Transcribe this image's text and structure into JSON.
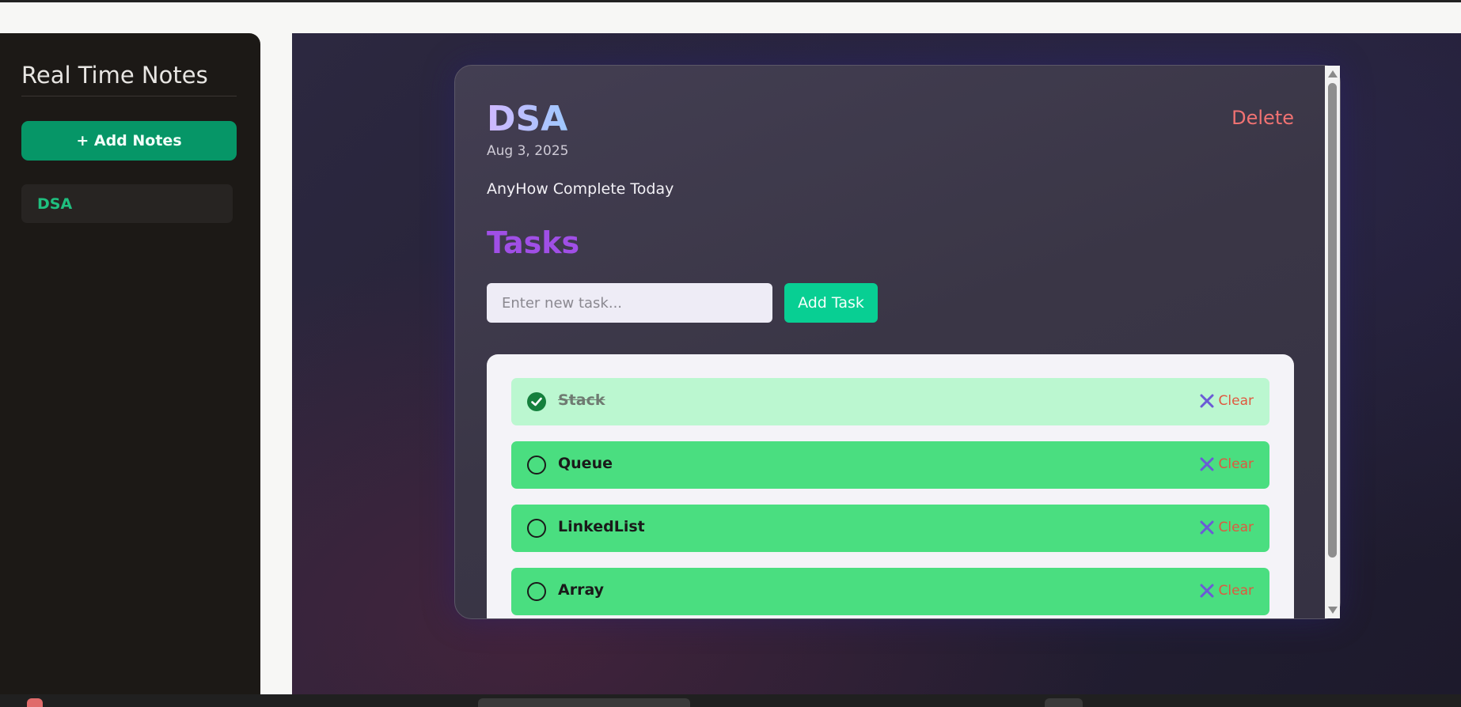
{
  "sidebar": {
    "title": "Real Time Notes",
    "add_button_label": "+ Add Notes",
    "notes": [
      {
        "label": "DSA"
      }
    ]
  },
  "note": {
    "title": "DSA",
    "delete_label": "Delete",
    "date": "Aug 3, 2025",
    "description": "AnyHow Complete Today",
    "tasks_heading": "Tasks",
    "task_input_placeholder": "Enter new task...",
    "add_task_label": "Add Task",
    "clear_label": "Clear",
    "tasks": [
      {
        "name": "Stack",
        "completed": true
      },
      {
        "name": "Queue",
        "completed": false
      },
      {
        "name": "LinkedList",
        "completed": false
      },
      {
        "name": "Array",
        "completed": false
      }
    ]
  },
  "colors": {
    "sidebar_bg": "#1c1916",
    "accent_green": "#069667",
    "task_green": "#4ade80",
    "task_done": "#bbf7d0",
    "delete_red": "#f07272",
    "tasks_heading_purple": "#a04fe6"
  }
}
